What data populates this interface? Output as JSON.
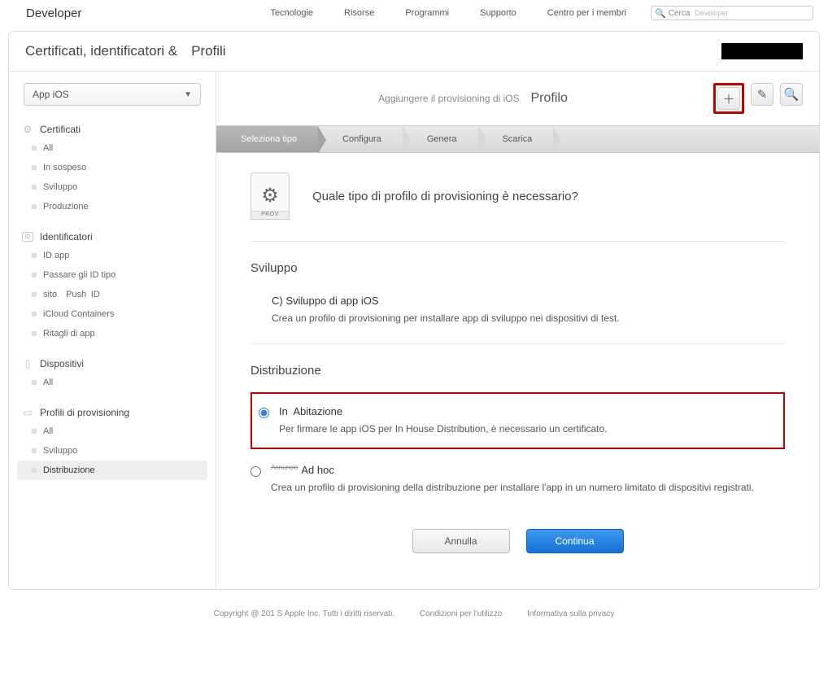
{
  "topnav": {
    "brand": "Developer",
    "links": [
      "Tecnologie",
      "Risorse",
      "Programmi",
      "Supporto",
      "Centro per i membri"
    ],
    "search_label": "Cerca",
    "search_ghost": "Developer"
  },
  "titlebar": {
    "title": "Certificati, identificatori &amp; Profili"
  },
  "sidebar": {
    "platform": "App iOS",
    "groups": [
      {
        "heading": "Certificati",
        "items": [
          "All",
          "In sospeso",
          "Sviluppo",
          "Produzione"
        ]
      },
      {
        "heading": "Identificatori",
        "items": [
          "ID app",
          "Passare gli ID tipo",
          "sito Push ID",
          "iCloud Containers",
          "Ritagli di app"
        ]
      },
      {
        "heading": "Dispositivi",
        "items": [
          "All"
        ]
      },
      {
        "heading": "Profili di provisioning",
        "items": [
          "All",
          "Sviluppo",
          "Distribuzione"
        ]
      }
    ]
  },
  "header": {
    "pre": "Aggiungere il provisioning di iOS",
    "title": "Profilo"
  },
  "steps": [
    "Seleziona tipo",
    "Configura",
    "Genera",
    "Scarica"
  ],
  "intro": {
    "badge": "PROV",
    "question": "Quale tipo di profilo di provisioning è necessario?"
  },
  "sections": {
    "dev_heading": "Sviluppo",
    "dev_option_title": "C) Sviluppo di app iOS",
    "dev_option_desc": "Crea un profilo di provisioning per installare app di sviluppo nei dispositivi di test.",
    "dist_heading": "Distribuzione",
    "inhouse_title": "In Abitazione",
    "inhouse_desc": "Per firmare le app iOS per In House Distribution, è necessario un certificato.",
    "adhoc_strike": "Annuncio",
    "adhoc_title": "Ad hoc",
    "adhoc_desc": "Crea un profilo di provisioning della distribuzione per installare l'app in un numero limitato di dispositivi registrati."
  },
  "buttons": {
    "cancel": "Annulla",
    "continue": "Continua"
  },
  "footer": {
    "copyright": "Copyright @ 201 S Apple Inc. Tutti i diritti riservati.",
    "terms": "Condizioni per l'utilizzo",
    "privacy": "Informativa sulla privacy"
  }
}
